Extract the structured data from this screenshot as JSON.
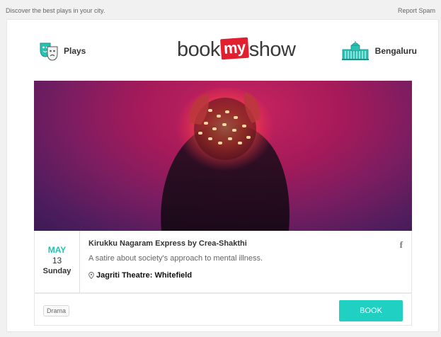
{
  "preheader": "Discover the best plays in your city.",
  "report_spam": "Report Spam",
  "header": {
    "category_label": "Plays",
    "category_icon": "theatre-masks-icon",
    "logo": {
      "pre": "book",
      "mid": "my",
      "post": "show",
      "accent": "#e21f2f"
    },
    "city_label": "Bengaluru",
    "city_icon": "city-landmark-icon"
  },
  "event": {
    "month": "MAY",
    "day": "13",
    "weekday": "Sunday",
    "title": "Kirukku Nagaram Express by Crea-Shakthi",
    "description": "A satire about society's approach to mental illness.",
    "venue": "Jagriti Theatre: Whitefield",
    "share_icon": "facebook-icon",
    "share_glyph": "f"
  },
  "footer": {
    "genre": "Drama",
    "book_label": "BOOK"
  },
  "colors": {
    "accent": "#20d0c2",
    "month": "#22c3b3",
    "brand_red": "#e21f2f"
  }
}
